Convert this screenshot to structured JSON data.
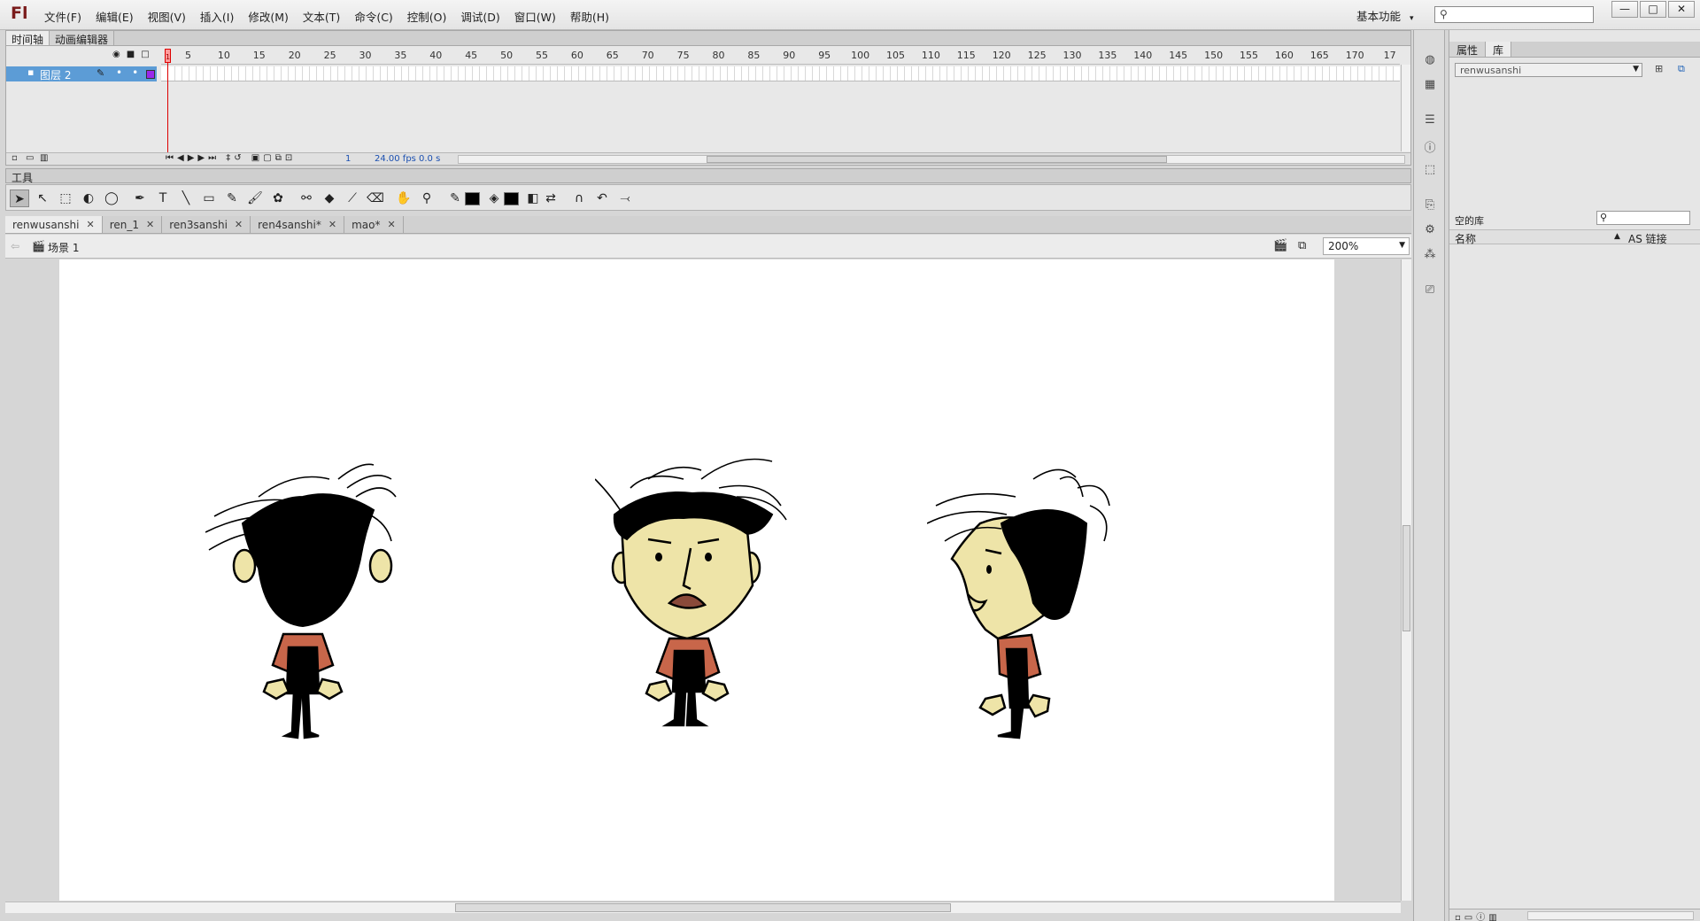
{
  "app": {
    "logo": "Fl"
  },
  "menu": [
    "文件(F)",
    "编辑(E)",
    "视图(V)",
    "插入(I)",
    "修改(M)",
    "文本(T)",
    "命令(C)",
    "控制(O)",
    "调试(D)",
    "窗口(W)",
    "帮助(H)"
  ],
  "workspace": {
    "label": "基本功能"
  },
  "window_controls": {
    "minimize": "—",
    "maximize": "□",
    "close": "✕"
  },
  "timeline": {
    "tabs": [
      "时间轴",
      "动画编辑器"
    ],
    "ruler": [
      "5",
      "10",
      "15",
      "20",
      "25",
      "30",
      "35",
      "40",
      "45",
      "50",
      "55",
      "60",
      "65",
      "70",
      "75",
      "80",
      "85",
      "90",
      "95",
      "100",
      "105",
      "110",
      "115",
      "120",
      "125",
      "130",
      "135",
      "140",
      "145",
      "150",
      "155",
      "160",
      "165",
      "170",
      "17"
    ],
    "first_frame_label": "1",
    "layer": {
      "name": "图层 2",
      "color": "#9a28ea"
    },
    "current_frame": "1",
    "fps": "24.00 fps",
    "time": "0.0 s"
  },
  "tools": {
    "label": "工具",
    "stroke_color": "#000000",
    "fill_color": "#000000"
  },
  "documents": [
    {
      "name": "renwusanshi",
      "active": true
    },
    {
      "name": "ren_1",
      "active": false
    },
    {
      "name": "ren3sanshi",
      "active": false
    },
    {
      "name": "ren4sanshi*",
      "active": false
    },
    {
      "name": "mao*",
      "active": false
    }
  ],
  "editbar": {
    "scene": "场景 1",
    "zoom": "200%"
  },
  "library": {
    "tabs": [
      "属性",
      "库"
    ],
    "document": "renwusanshi",
    "empty_label": "空的库",
    "columns": {
      "name": "名称",
      "linkage": "AS 链接"
    }
  },
  "stage_characters": [
    "back",
    "front",
    "side"
  ]
}
